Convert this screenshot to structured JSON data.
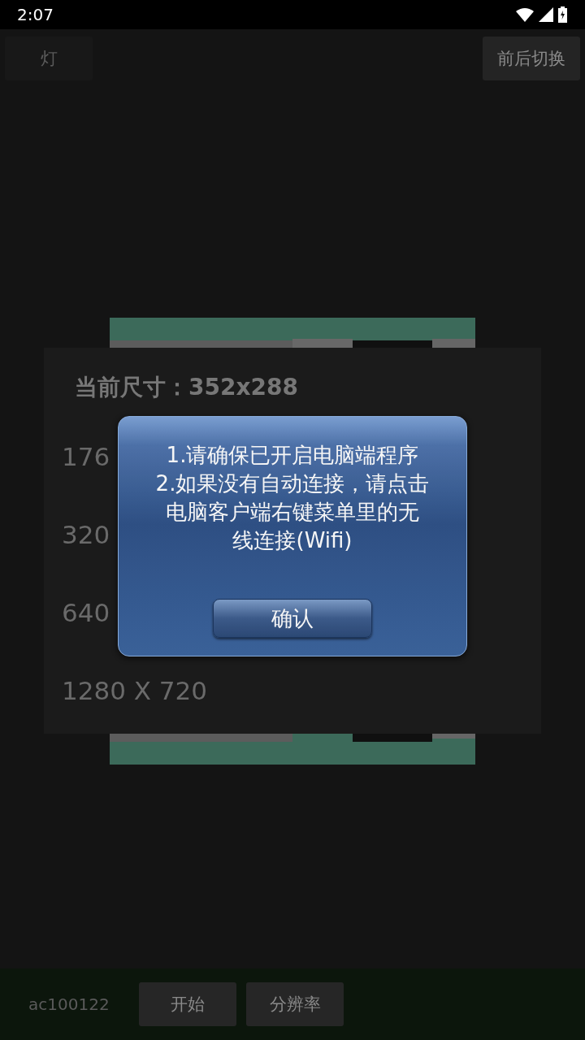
{
  "status_bar": {
    "time": "2:07"
  },
  "top_buttons": [
    {
      "label": "灯",
      "disabled": true
    },
    {
      "label": "前后切换",
      "disabled": false
    }
  ],
  "resolution_panel": {
    "current": "当前尺寸：352x288",
    "options": [
      "176",
      "320",
      "640",
      "1280 X 720"
    ]
  },
  "dialog": {
    "lines": [
      "1.请确保已开启电脑端程序",
      "2.如果没有自动连接，请点击",
      "电脑客户端右键菜单里的无",
      "线连接(Wifi)"
    ],
    "button": "确认"
  },
  "bottom_bar": {
    "device_id": "ac100122",
    "buttons": [
      "开始",
      "分辨率"
    ]
  }
}
